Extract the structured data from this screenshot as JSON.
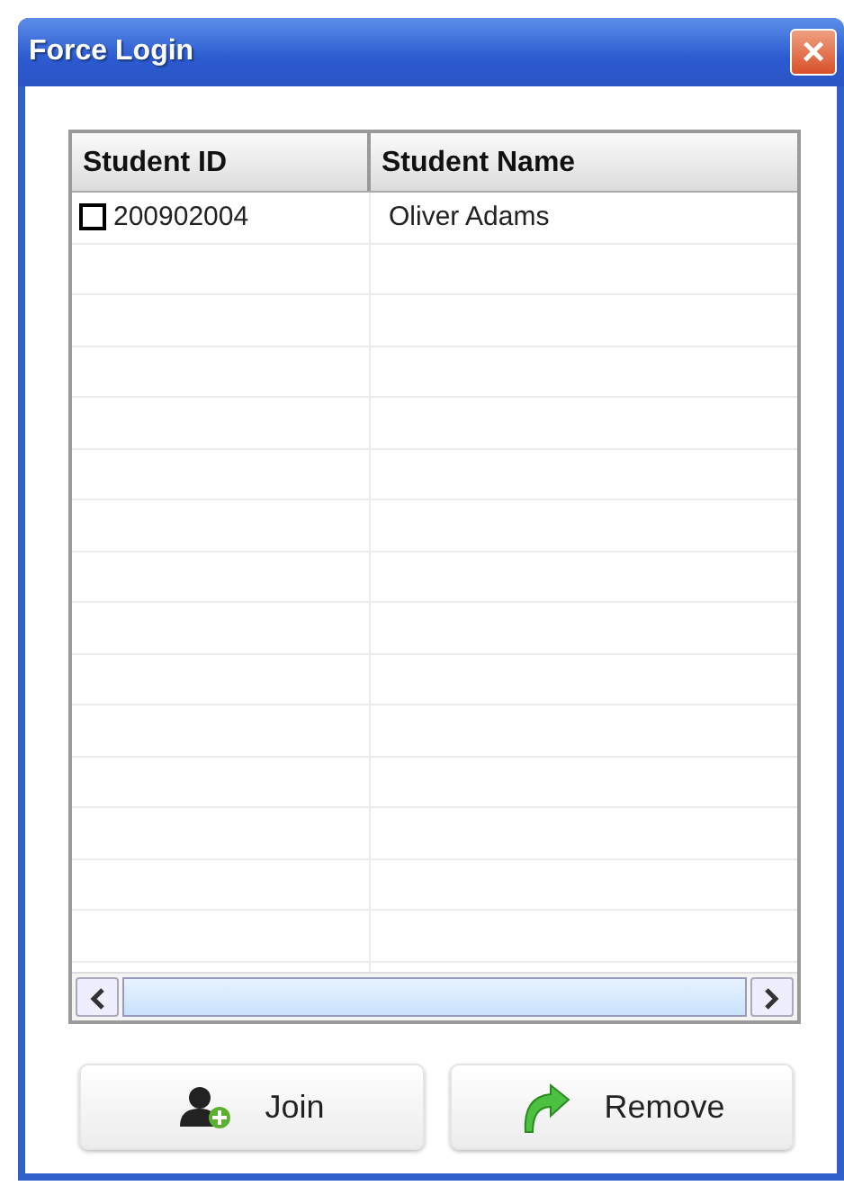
{
  "window": {
    "title": "Force Login",
    "close": "×"
  },
  "table": {
    "columns": [
      "Student ID",
      "Student Name"
    ],
    "rows": [
      {
        "student_id": "200902004",
        "student_name": "Oliver Adams",
        "checked": false
      }
    ]
  },
  "buttons": [
    {
      "kind": "join",
      "label": "Join"
    },
    {
      "kind": "remove",
      "label": "Remove"
    }
  ]
}
